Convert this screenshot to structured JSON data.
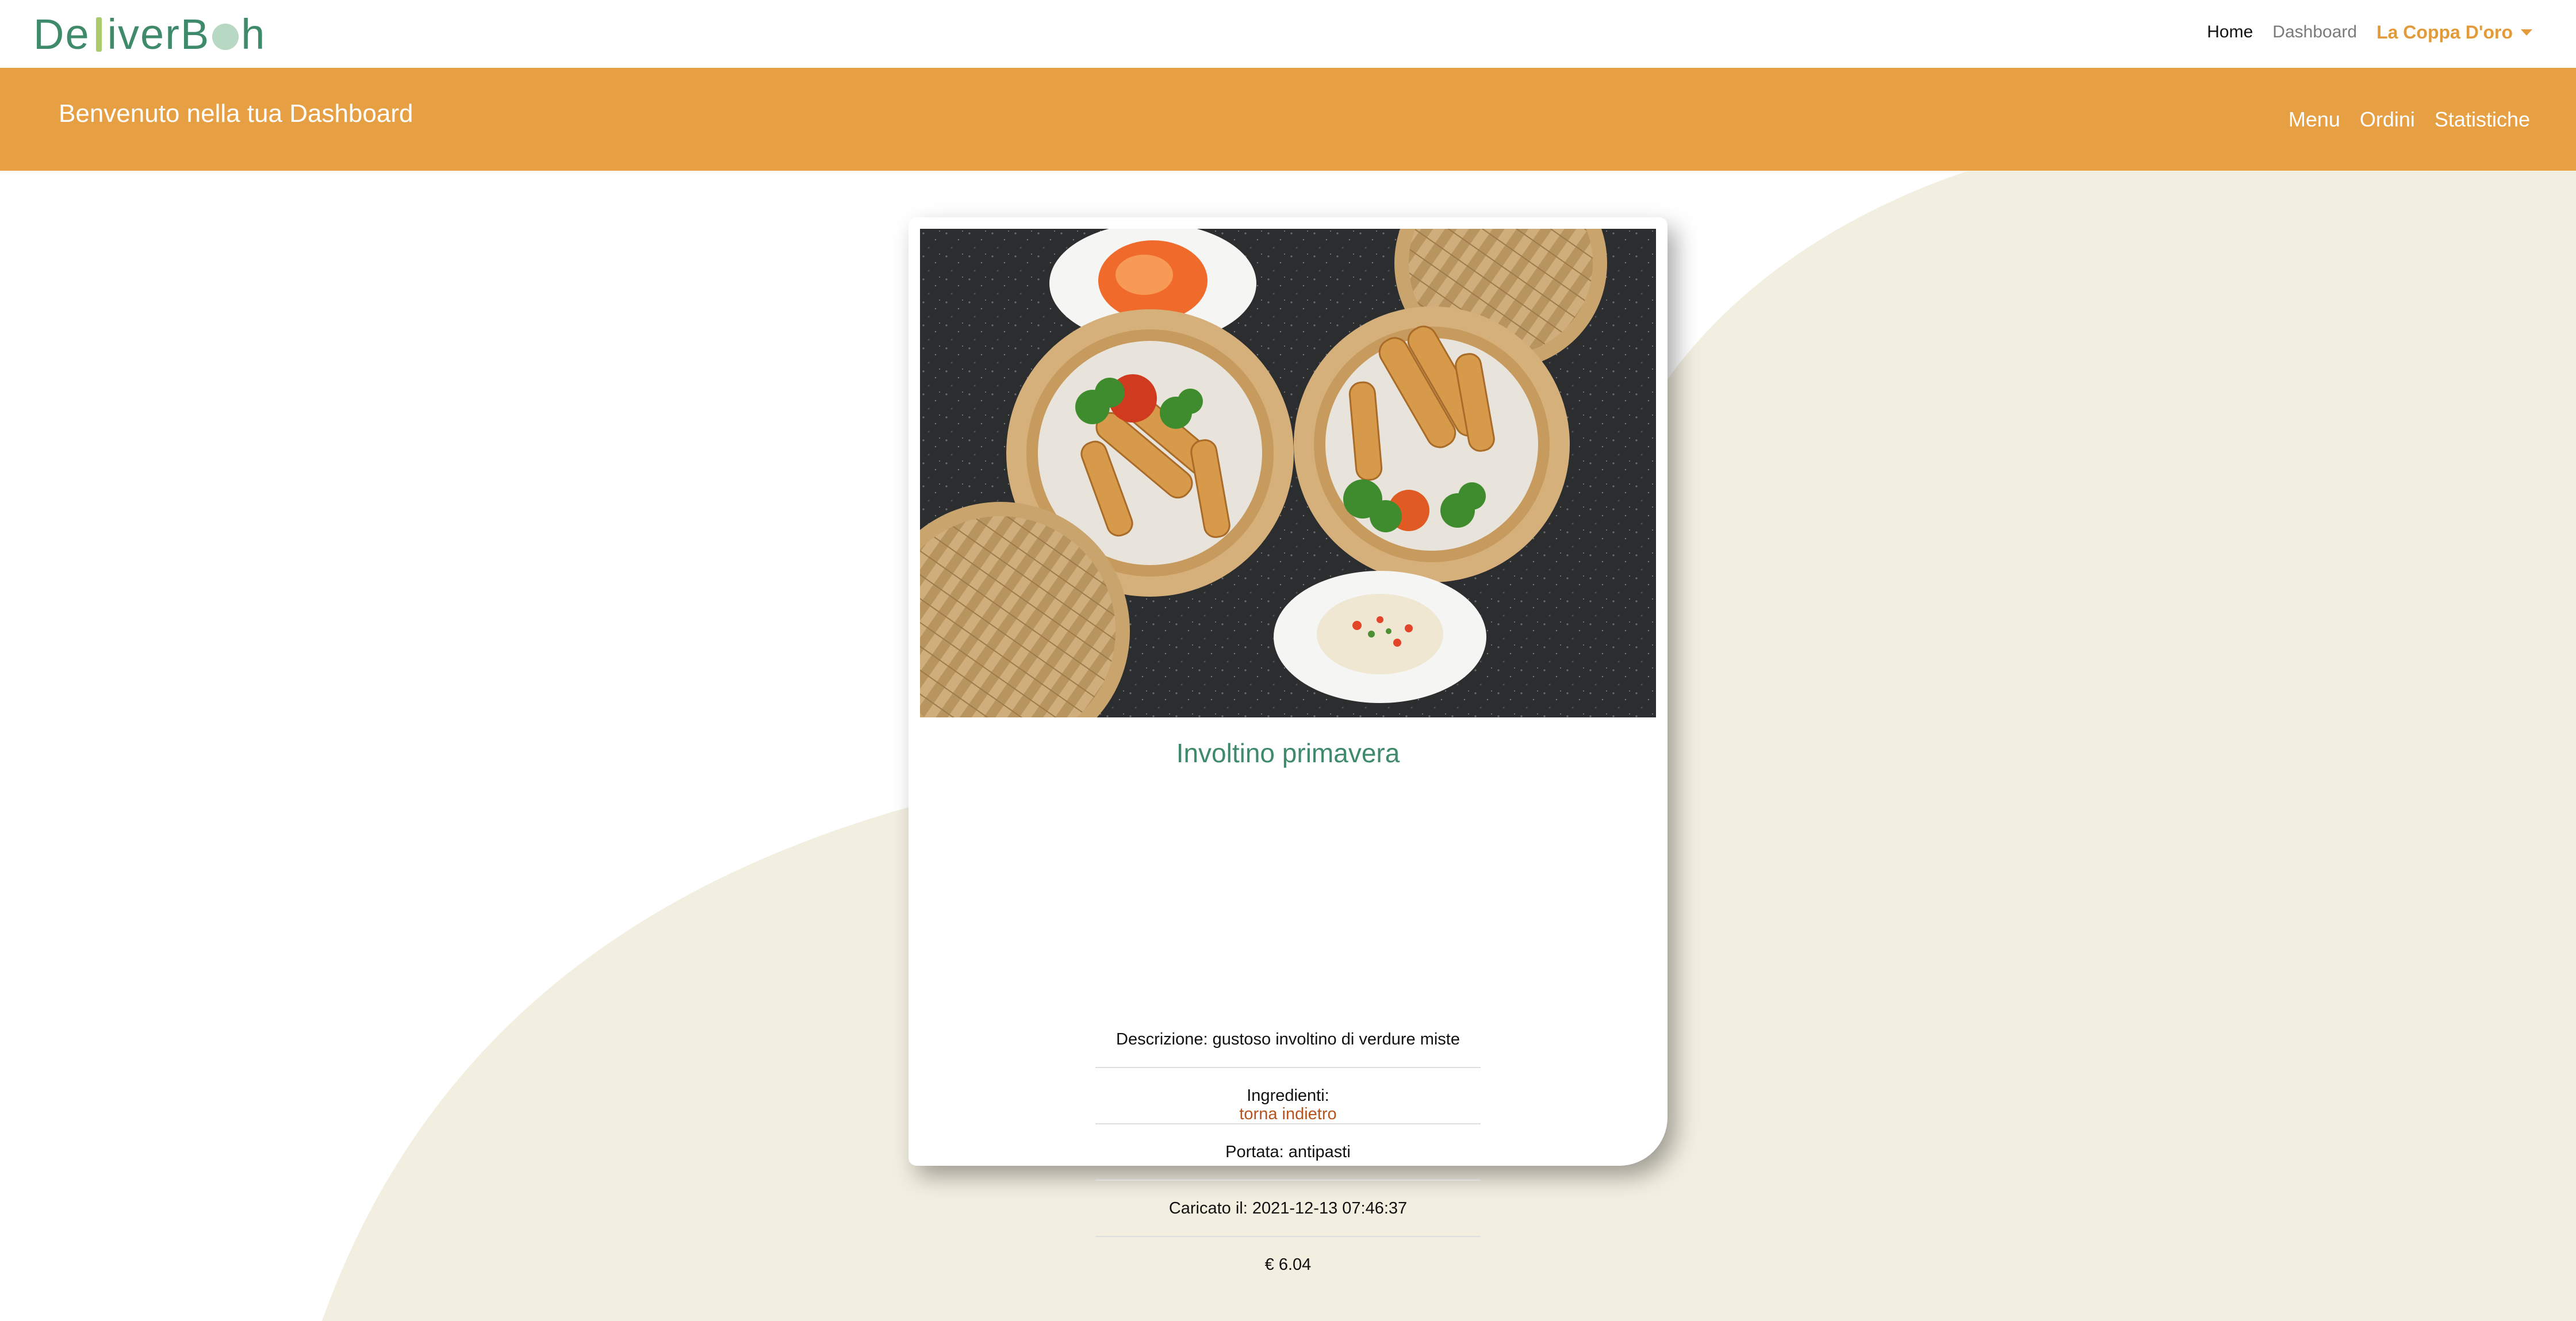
{
  "brand": {
    "name": "DeliverBoh"
  },
  "topnav": {
    "home": "Home",
    "dashboard": "Dashboard",
    "user": "La Coppa D'oro"
  },
  "band": {
    "title": "Benvenuto nella tua Dashboard",
    "links": [
      "Menu",
      "Ordini",
      "Statistiche"
    ]
  },
  "dish": {
    "name": "Involtino primavera",
    "details": [
      "Descrizione: gustoso involtino di verdure miste",
      "Ingredienti:",
      "Portata: antipasti",
      "Caricato il: 2021-12-13 07:46:37",
      "€ 6.04"
    ],
    "back": "torna indietro"
  },
  "colors": {
    "accent": "#e6a043",
    "brand_green": "#3f8a6b",
    "background_wave": "#f2eee0",
    "back_link": "#b5541c"
  }
}
